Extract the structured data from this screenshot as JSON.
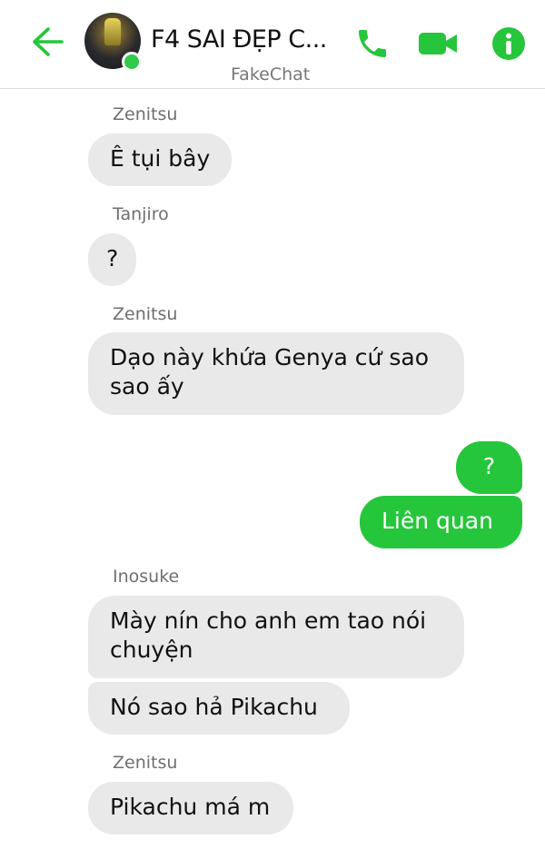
{
  "header": {
    "title": "F4 SAI ĐẸP C...",
    "app_name": "FakeChat",
    "back_icon": "arrow-left-icon",
    "call_icon": "phone-icon",
    "video_icon": "video-camera-icon",
    "info_icon": "info-icon",
    "accent_color": "#25c63b"
  },
  "messages": [
    {
      "sender": "Zenitsu",
      "text": "Ê tụi bây"
    },
    {
      "sender": "Tanjiro",
      "text": "?"
    },
    {
      "sender": "Zenitsu",
      "lines": [
        "Dạo này khứa Genya cứ sao",
        "sao ấy"
      ]
    },
    {
      "sender": "me",
      "text": "?"
    },
    {
      "sender": "me",
      "text": "Liên quan"
    },
    {
      "sender": "Inosuke",
      "lines": [
        "Mày nín cho anh em tao nói",
        "chuyện"
      ]
    },
    {
      "sender": "Inosuke",
      "text": "Nó sao hả Pikachu"
    },
    {
      "sender": "Zenitsu",
      "text": "Pikachu má m"
    }
  ],
  "colors": {
    "incoming_bubble": "#e9e9e9",
    "outgoing_bubble": "#25c63b"
  }
}
